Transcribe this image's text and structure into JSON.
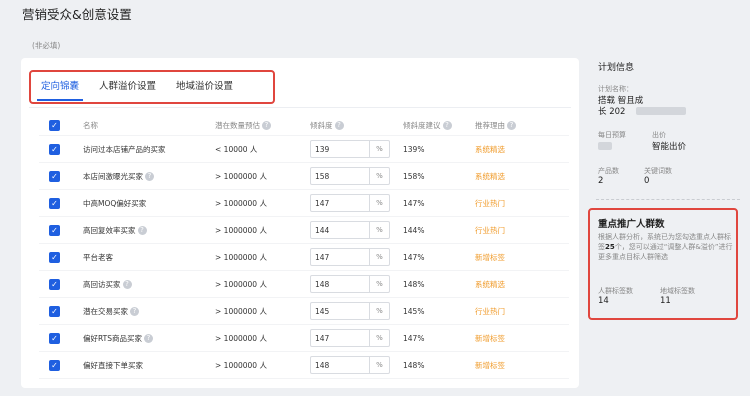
{
  "page": {
    "title": "营销受众&创意设置",
    "optional_label": "(非必填)"
  },
  "tabs": [
    {
      "label": "定向锦囊",
      "active": true
    },
    {
      "label": "人群溢价设置",
      "active": false
    },
    {
      "label": "地域溢价设置",
      "active": false
    }
  ],
  "table": {
    "headers": {
      "name": "名称",
      "potential": "潜在数量预估",
      "slope": "倾斜度",
      "suggest": "倾斜度建议",
      "reason": "推荐理由"
    },
    "unit": "%",
    "rows": [
      {
        "name": "访问过本店铺产品的买家",
        "potential": "< 10000 人",
        "slope": "139",
        "suggest": "139%",
        "reason": "系统精选"
      },
      {
        "name": "本店间激曝光买家",
        "potential": "> 1000000 人",
        "slope": "158",
        "suggest": "158%",
        "reason": "系统精选"
      },
      {
        "name": "中高MOQ偏好买家",
        "potential": "> 1000000 人",
        "slope": "147",
        "suggest": "147%",
        "reason": "行业热门"
      },
      {
        "name": "高回复效率买家",
        "potential": "> 1000000 人",
        "slope": "144",
        "suggest": "144%",
        "reason": "行业热门"
      },
      {
        "name": "平台老客",
        "potential": "> 1000000 人",
        "slope": "147",
        "suggest": "147%",
        "reason": "新增标签"
      },
      {
        "name": "高回访买家",
        "potential": "> 1000000 人",
        "slope": "148",
        "suggest": "148%",
        "reason": "系统精选"
      },
      {
        "name": "潜在交易买家",
        "potential": "> 1000000 人",
        "slope": "145",
        "suggest": "145%",
        "reason": "行业热门"
      },
      {
        "name": "偏好RTS商品买家",
        "potential": "> 1000000 人",
        "slope": "147",
        "suggest": "147%",
        "reason": "新增标签"
      },
      {
        "name": "偏好直接下单买家",
        "potential": "> 1000000 人",
        "slope": "148",
        "suggest": "148%",
        "reason": "新增标签"
      }
    ]
  },
  "sidebar": {
    "title": "计划信息",
    "plan_name_label": "计划名称：",
    "plan_name_line1": "搭载 智且成",
    "plan_name_line2": "长 202",
    "budget_label": "每日预算",
    "bid_label": "出价",
    "bid_value": "智能出价",
    "product_count_label": "产品数",
    "product_count": "2",
    "keyword_count_label": "关键词数",
    "keyword_count": "0",
    "focus": {
      "title": "重点推广人群数",
      "desc_prefix": "根据人群分析，系统已为您勾选重点人群标签",
      "desc_count": "25",
      "desc_suffix": "个，您可以通过“调整人群&溢价”进行更多重点目标人群筛选",
      "crowd_label": "人群标签数",
      "crowd_value": "14",
      "region_label": "地域标签数",
      "region_value": "11"
    }
  }
}
